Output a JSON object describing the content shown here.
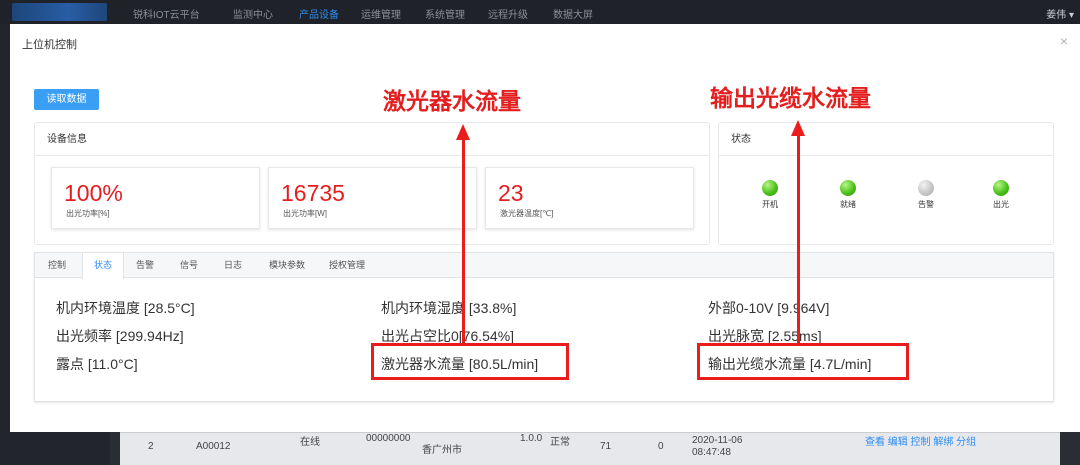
{
  "app": {
    "brand": "锐科IOT云平台",
    "nav": [
      "监测中心",
      "产品设备",
      "运维管理",
      "系统管理",
      "远程升级",
      "数据大屏"
    ],
    "active_nav": "产品设备",
    "user": "姜伟"
  },
  "background_table": {
    "row": [
      "2",
      "A00012",
      "在线",
      "00000000",
      "香广州市",
      "1.0.0",
      "正常",
      "71",
      "0",
      "2020-11-06 08:47:48"
    ],
    "actions": "查看 编辑 控制 解绑 分组"
  },
  "modal": {
    "title": "上位机控制",
    "close_icon": "close-icon",
    "read_button": "读取数据",
    "device_info": {
      "title": "设备信息",
      "stats": [
        {
          "value": "100%",
          "label": "出光功率[%]"
        },
        {
          "value": "16735",
          "label": "出光功率[W]"
        },
        {
          "value": "23",
          "label": "激光器温度[℃]"
        }
      ]
    },
    "status_panel": {
      "title": "状态",
      "indicators": [
        {
          "label": "开机",
          "state": "on"
        },
        {
          "label": "就绪",
          "state": "on"
        },
        {
          "label": "告警",
          "state": "off"
        },
        {
          "label": "出光",
          "state": "on"
        }
      ],
      "colors": {
        "on": "#4cc21a",
        "off": "#c7c7c7"
      }
    },
    "tabs": [
      "控制",
      "状态",
      "告警",
      "信号",
      "日志",
      "模块参数",
      "授权管理"
    ],
    "active_tab": "状态",
    "metrics": [
      [
        "机内环境温度 [28.5°C]",
        "机内环境湿度 [33.8%]",
        "外部0-10V [9.964V]"
      ],
      [
        "出光频率 [299.94Hz]",
        "出光占空比0[76.54%]",
        "出光脉宽 [2.55ms]"
      ],
      [
        "露点 [11.0°C]",
        "激光器水流量 [80.5L/min]",
        "输出光缆水流量 [4.7L/min]"
      ]
    ]
  },
  "annotations": {
    "left": "激光器水流量",
    "right": "输出光缆水流量",
    "color": "#ea1c1c"
  }
}
